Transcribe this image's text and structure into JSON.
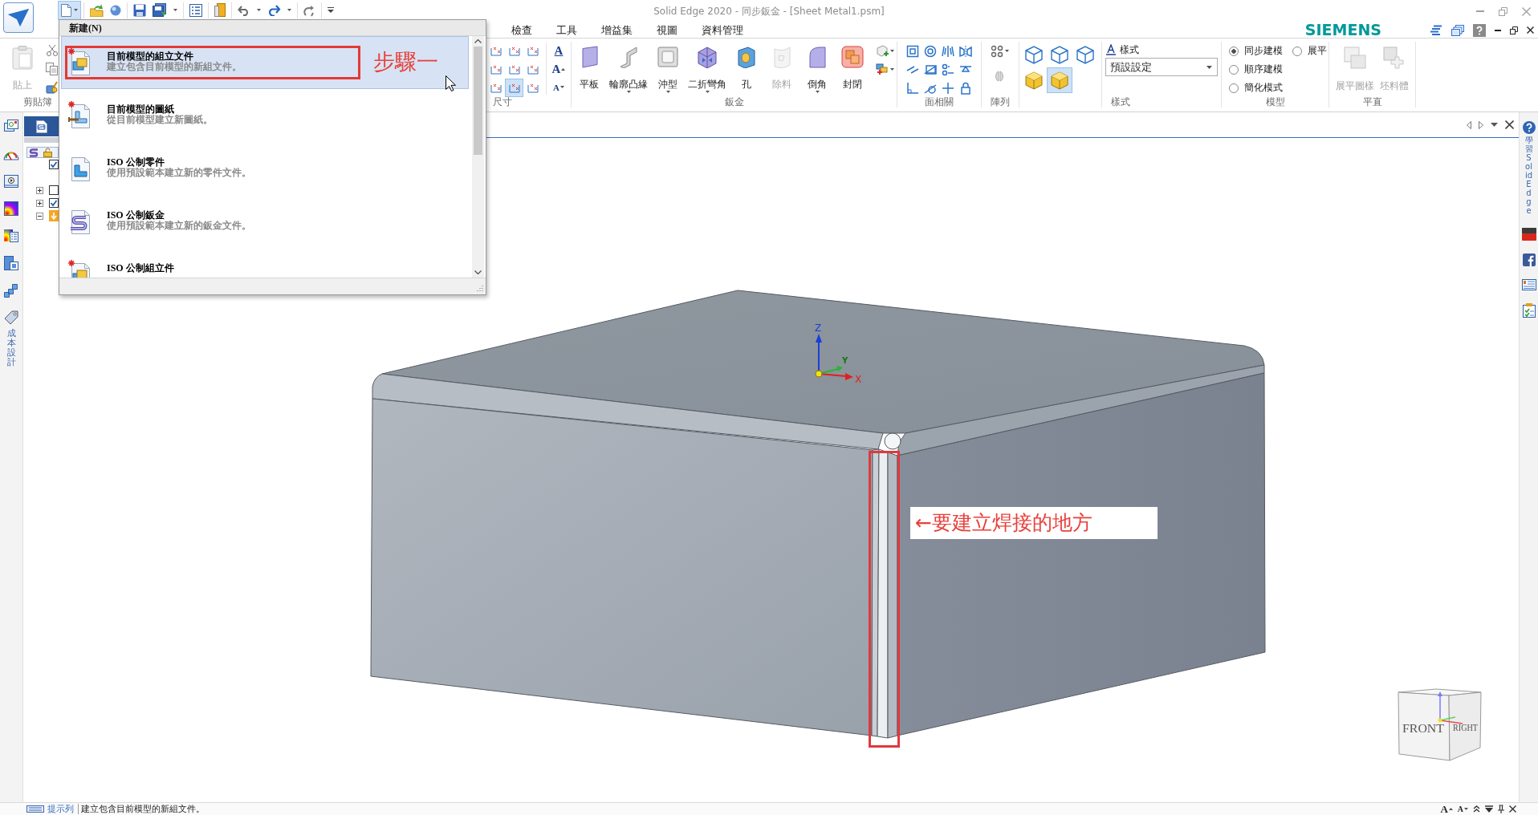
{
  "window": {
    "title": "Solid Edge 2020 - 同步鈑金 - [Sheet Metal1.psm]"
  },
  "quick_access_toolbar": {
    "new_button_pressed": true
  },
  "brand": "SIEMENS",
  "ribbon_tabs": [
    {
      "label": "檢查",
      "selected": false
    },
    {
      "label": "工具",
      "selected": false
    },
    {
      "label": "增益集",
      "selected": false
    },
    {
      "label": "視圖",
      "selected": false
    },
    {
      "label": "資料管理",
      "selected": false
    }
  ],
  "ribbon": {
    "groups": [
      {
        "kind": "clipboard",
        "label": "剪貼簿",
        "paste": {
          "label": "貼上",
          "disabled": true
        }
      },
      {
        "kind": "dimension",
        "label": "尺寸",
        "tools": [
          {
            "on": false
          },
          {
            "on": false
          },
          {
            "on": false
          },
          {
            "on": false
          },
          {
            "on": false
          },
          {
            "on": false
          },
          {
            "on": false
          },
          {
            "on": true
          },
          {
            "on": false
          }
        ],
        "text_tools": [
          {
            "label": "A",
            "kind": "style"
          },
          {
            "label": "A",
            "kind": "increase"
          },
          {
            "label": "A",
            "kind": "decrease"
          }
        ]
      },
      {
        "kind": "sheet_metal",
        "label": "鈑金",
        "commands": [
          {
            "label": "平板",
            "dropdown": false,
            "disabled": false
          },
          {
            "label": "輪廓凸緣",
            "dropdown": true,
            "disabled": false
          },
          {
            "label": "沖型",
            "dropdown": true,
            "disabled": false
          },
          {
            "label": "二折彎角",
            "dropdown": true,
            "disabled": false
          },
          {
            "label": "孔",
            "dropdown": false,
            "disabled": false
          },
          {
            "label": "除料",
            "dropdown": false,
            "disabled": true
          },
          {
            "label": "倒角",
            "dropdown": true,
            "disabled": false
          },
          {
            "label": "封閉",
            "dropdown": false,
            "disabled": false
          }
        ]
      },
      {
        "kind": "icon_grid",
        "label": "面相關"
      },
      {
        "kind": "pattern",
        "label": "陣列"
      },
      {
        "kind": "views",
        "views": [
          {
            "selected": false
          },
          {
            "selected": false
          },
          {
            "selected": false
          },
          {
            "selected": false
          },
          {
            "selected": true
          }
        ]
      },
      {
        "kind": "style",
        "label": "樣式",
        "header": "樣式",
        "value": "預設設定"
      },
      {
        "kind": "radios",
        "label": "模型",
        "options": [
          {
            "label": "同步建模",
            "selected": true
          },
          {
            "label": "展平",
            "selected": false
          },
          {
            "label": "順序建模",
            "selected": false
          },
          {
            "label": "簡化模式",
            "selected": false
          }
        ]
      },
      {
        "kind": "flat_pattern",
        "label": "平直",
        "commands": [
          {
            "label": "展平圖樣",
            "dropdown": false,
            "disabled": true
          },
          {
            "label": "坯料體",
            "dropdown": false,
            "disabled": true
          }
        ]
      }
    ]
  },
  "left_strip": {
    "tab_label": "成本設計"
  },
  "tree": {
    "items": [
      {
        "children": [
          {
            "kind": "checkbox",
            "checked": true
          },
          {
            "kind": "checkbox",
            "expanded": false,
            "checked": false
          },
          {
            "kind": "checkbox",
            "expanded": false,
            "checked": true
          },
          {
            "kind": "folder",
            "expanded": true
          }
        ]
      }
    ]
  },
  "viewport": {
    "triad": {
      "z": "Z",
      "y": "Y",
      "x": "X"
    },
    "callout": "←要建立焊接的地方",
    "view_cube": {
      "front": "FRONT",
      "right": "RIGHT"
    }
  },
  "right_strip": {
    "learn_label": "學習 Solid Edge"
  },
  "status_bar": {
    "label": "提示列",
    "prompt": "建立包含目前模型的新組文件。",
    "font_buttons": [
      {
        "label": "A",
        "kind": "increase"
      },
      {
        "label": "A",
        "kind": "decrease"
      }
    ]
  },
  "new_menu": {
    "header": "新建(N)",
    "items": [
      {
        "kind": "assembly",
        "title": "目前模型的組立文件",
        "description": "建立包含目前模型的新組文件。",
        "selected": true
      },
      {
        "kind": "drawing",
        "title": "目前模型的圖紙",
        "description": "從目前模型建立新圖紙。",
        "selected": false
      },
      {
        "kind": "part",
        "title": "ISO 公制零件",
        "description": "使用預設範本建立新的零件文件。",
        "selected": false
      },
      {
        "kind": "sheet_metal",
        "title": "ISO 公制鈑金",
        "description": "使用預設範本建立新的鈑金文件。",
        "selected": false
      },
      {
        "kind": "assembly",
        "title": "ISO 公制組立件",
        "selected": false
      }
    ],
    "step_label": "步驟一"
  }
}
